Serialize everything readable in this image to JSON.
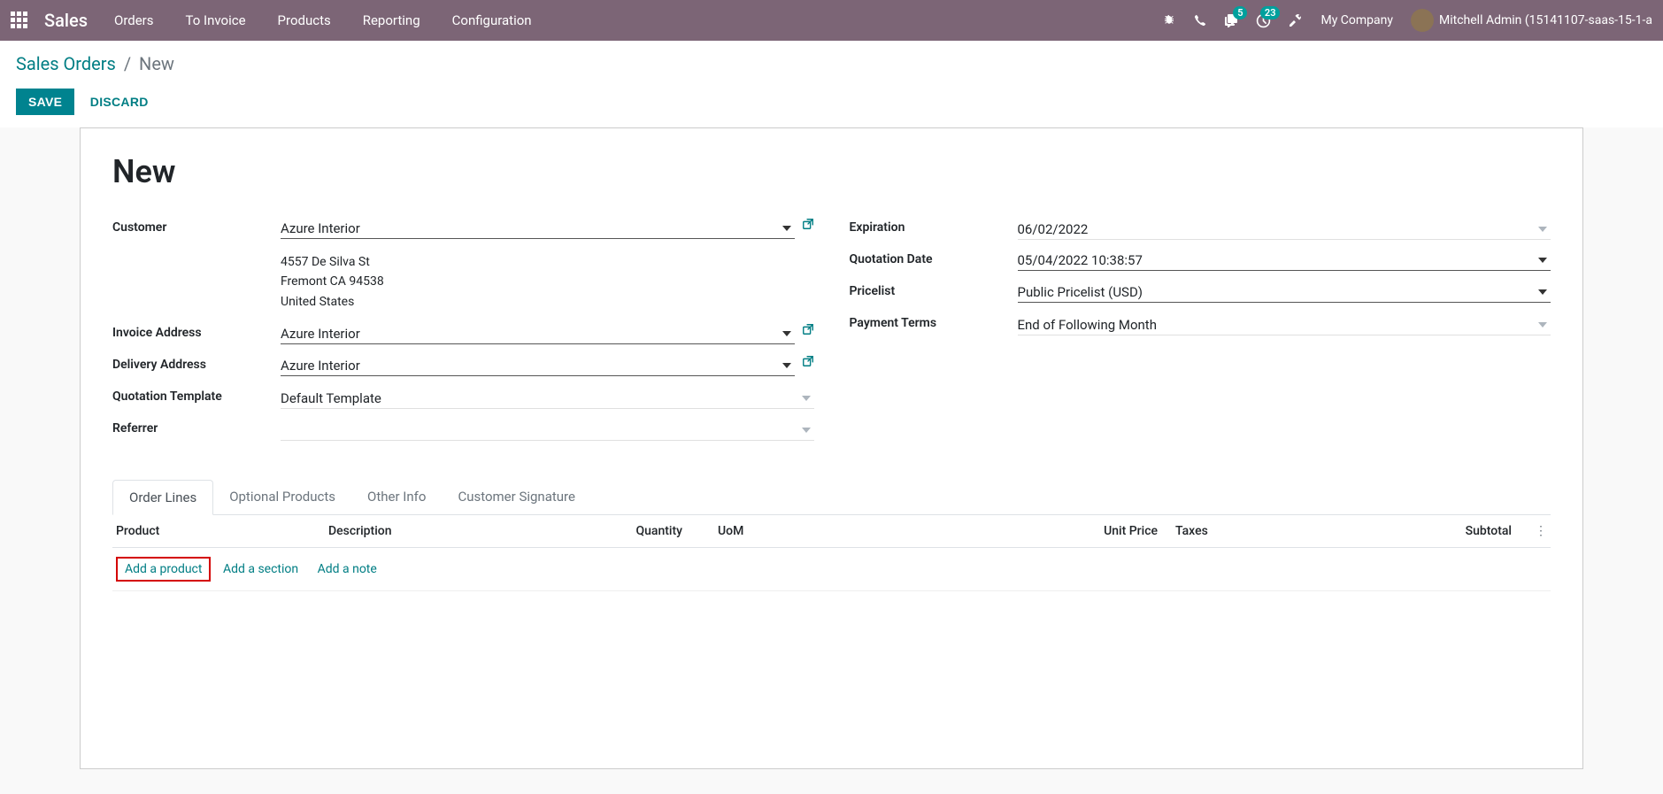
{
  "navbar": {
    "brand": "Sales",
    "menu": [
      "Orders",
      "To Invoice",
      "Products",
      "Reporting",
      "Configuration"
    ],
    "msg_count": "5",
    "activity_count": "23",
    "company": "My Company",
    "user": "Mitchell Admin (15141107-saas-15-1-a"
  },
  "breadcrumb": {
    "link": "Sales Orders",
    "current": "New"
  },
  "buttons": {
    "save": "SAVE",
    "discard": "DISCARD"
  },
  "title": "New",
  "left": {
    "customer_label": "Customer",
    "customer": "Azure Interior",
    "addr1": "4557 De Silva St",
    "addr2": "Fremont CA 94538",
    "addr3": "United States",
    "invoice_label": "Invoice Address",
    "invoice": "Azure Interior",
    "delivery_label": "Delivery Address",
    "delivery": "Azure Interior",
    "template_label": "Quotation Template",
    "template": "Default Template",
    "referrer_label": "Referrer",
    "referrer": ""
  },
  "right": {
    "expiration_label": "Expiration",
    "expiration": "06/02/2022",
    "quote_date_label": "Quotation Date",
    "quote_date": "05/04/2022 10:38:57",
    "pricelist_label": "Pricelist",
    "pricelist": "Public Pricelist (USD)",
    "terms_label": "Payment Terms",
    "terms": "End of Following Month"
  },
  "tabs": [
    "Order Lines",
    "Optional Products",
    "Other Info",
    "Customer Signature"
  ],
  "columns": {
    "product": "Product",
    "description": "Description",
    "quantity": "Quantity",
    "uom": "UoM",
    "unit_price": "Unit Price",
    "taxes": "Taxes",
    "subtotal": "Subtotal"
  },
  "add_links": {
    "product": "Add a product",
    "section": "Add a section",
    "note": "Add a note"
  }
}
